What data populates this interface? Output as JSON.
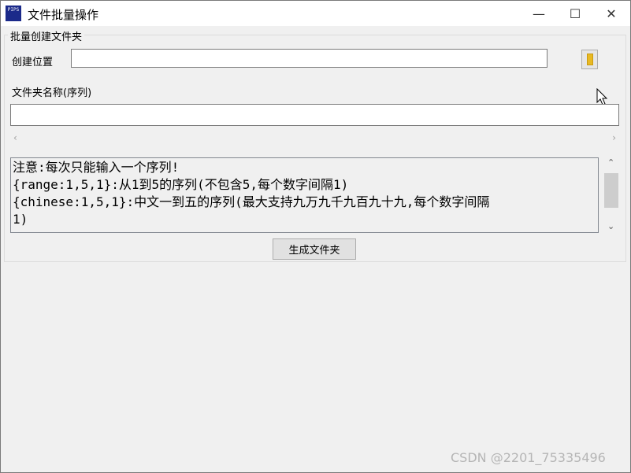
{
  "window": {
    "title": "文件批量操作",
    "icon": "app-icon",
    "icon_text": "PIPS"
  },
  "titlebar_buttons": {
    "minimize": "—",
    "maximize": "☐",
    "close": "✕"
  },
  "group": {
    "title": "批量创建文件夹",
    "location_label": "创建位置",
    "location_value": "",
    "folder_icon": "folder-icon",
    "name_label": "文件夹名称(序列)",
    "name_value": ""
  },
  "hscroll": {
    "left": "‹",
    "right": "›"
  },
  "vscroll": {
    "up": "⌃",
    "down": "⌄"
  },
  "instructions": [
    "注意:每次只能输入一个序列!",
    "{range:1,5,1}:从1到5的序列(不包含5,每个数字间隔1)",
    "{chinese:1,5,1}:中文一到五的序列(最大支持九万九千九百九十九,每个数字间隔",
    "1)"
  ],
  "generate_button": "生成文件夹",
  "watermark": "CSDN @2201_75335496",
  "colors": {
    "folder": "#e8b923",
    "titlebar": "#ffffff",
    "background": "#f0f0f0"
  }
}
